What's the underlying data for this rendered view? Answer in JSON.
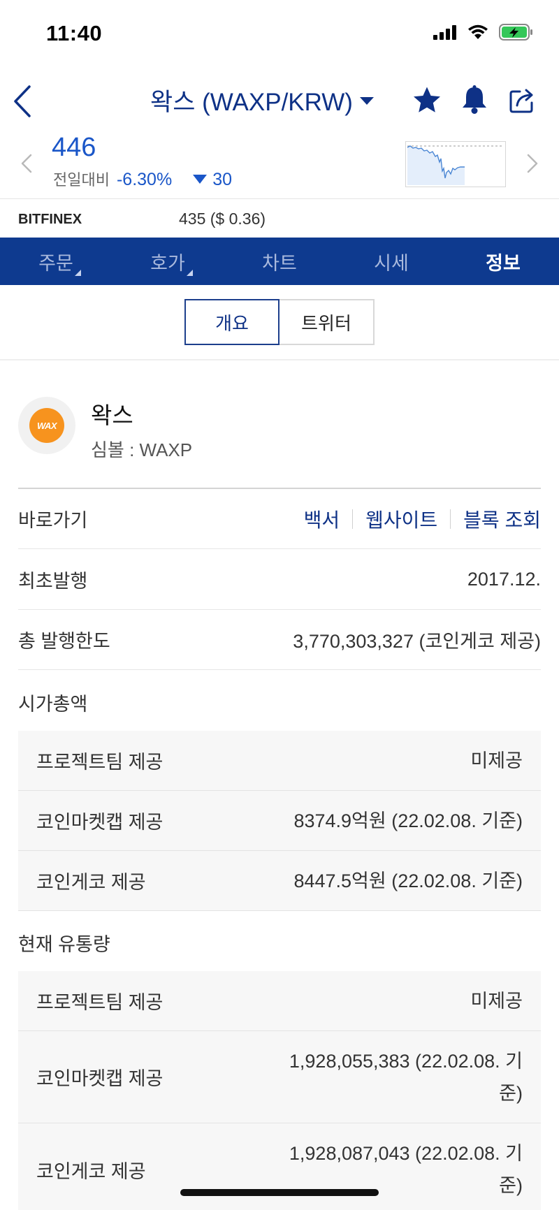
{
  "status_bar": {
    "time": "11:40",
    "icons": [
      "cellular-signal-icon",
      "wifi-icon",
      "battery-charging-icon"
    ]
  },
  "header": {
    "title": "왁스 (WAXP/KRW)",
    "icons": [
      "back-chevron-icon",
      "star-icon",
      "bell-icon",
      "share-icon"
    ]
  },
  "price": {
    "current": "446",
    "compare_label": "전일대비",
    "change_percent": "-6.30%",
    "change_value": "30"
  },
  "exchange": {
    "name": "BITFINEX",
    "price": "435 ($ 0.36)"
  },
  "tabs": [
    {
      "label": "주문"
    },
    {
      "label": "호가"
    },
    {
      "label": "차트"
    },
    {
      "label": "시세"
    },
    {
      "label": "정보"
    }
  ],
  "active_tab": "정보",
  "segments": [
    {
      "label": "개요"
    },
    {
      "label": "트위터"
    }
  ],
  "coin": {
    "logo_text": "WAX",
    "name": "왁스",
    "symbol": "심볼 : WAXP"
  },
  "shortcuts": {
    "label": "바로가기",
    "links": [
      "백서",
      "웹사이트",
      "블록 조회"
    ]
  },
  "first_issue": {
    "label": "최초발행",
    "value": "2017.12."
  },
  "total_supply": {
    "label": "총 발행한도",
    "value": "3,770,303,327 (코인게코 제공)"
  },
  "market_cap": {
    "label": "시가총액",
    "rows": [
      {
        "source": "프로젝트팀 제공",
        "value": "미제공"
      },
      {
        "source": "코인마켓캡 제공",
        "value": "8374.9억원 (22.02.08. 기준)"
      },
      {
        "source": "코인게코 제공",
        "value": "8447.5억원 (22.02.08. 기준)"
      }
    ]
  },
  "circulating": {
    "label": "현재 유통량",
    "rows": [
      {
        "source": "프로젝트팀 제공",
        "value": "미제공"
      },
      {
        "source": "코인마켓캡 제공",
        "value_line1": "1,928,055,383 (22.02.08. 기",
        "value_line2": "준)"
      },
      {
        "source": "코인게코 제공",
        "value_line1": "1,928,087,043 (22.02.08. 기",
        "value_line2": "준)"
      }
    ]
  },
  "colors": {
    "brand_navy": "#0e3a8f",
    "price_blue": "#1a56c8",
    "wax_orange": "#f7931e"
  }
}
